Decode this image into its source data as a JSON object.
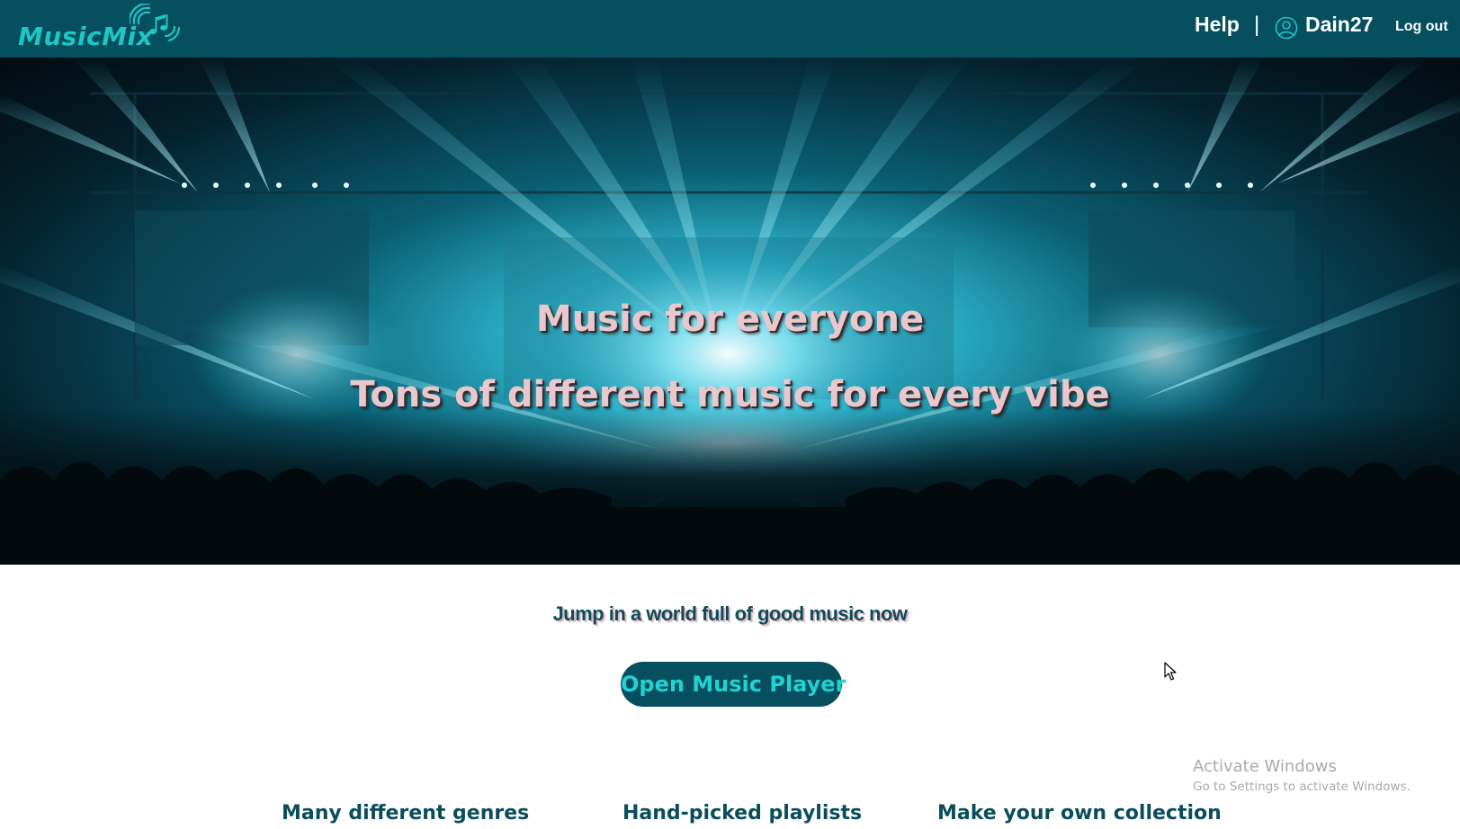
{
  "navbar": {
    "brand": "MusicMix",
    "help_label": "Help",
    "separator": "|",
    "username": "Dain27",
    "logout_label": "Log out",
    "background_color": "#054f5f",
    "brand_color": "#1fc6c6"
  },
  "hero": {
    "title": "Music for everyone",
    "subtitle": "Tons of different music for every vibe",
    "text_color": "#e8c8cc"
  },
  "cta": {
    "tagline": "Jump in a world full of good music now",
    "button_label": "Open Music Player",
    "button_bg": "#054f5f",
    "button_text_color": "#1fd3d3"
  },
  "features": [
    {
      "heading": "Many different genres"
    },
    {
      "heading": "Hand-picked playlists"
    },
    {
      "heading": "Make your own collection"
    }
  ],
  "os_overlay": {
    "title": "Activate Windows",
    "subtitle": "Go to Settings to activate Windows."
  },
  "icons": {
    "logo": "music-waves-icon",
    "user": "user-circle-icon",
    "cursor": "mouse-pointer-icon"
  }
}
